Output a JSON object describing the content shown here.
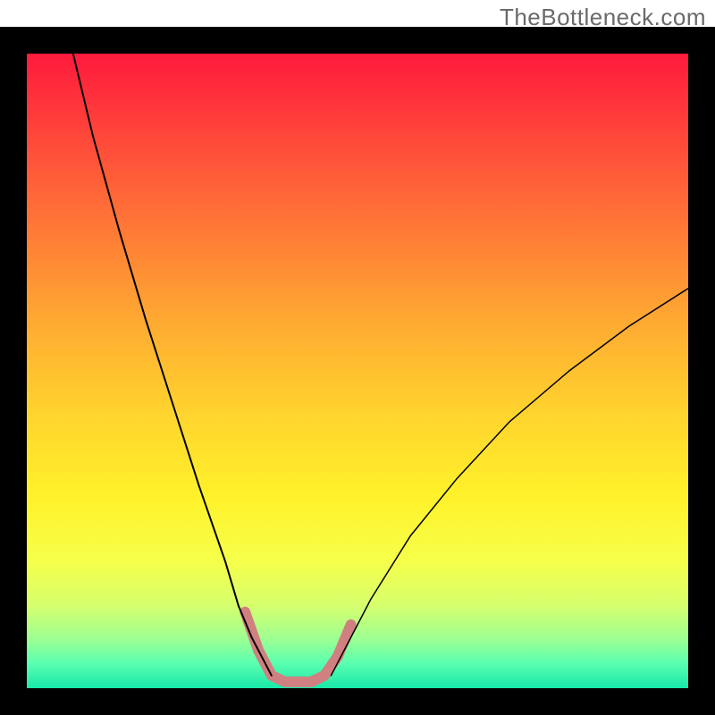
{
  "watermark": "TheBottleneck.com",
  "chart_data": {
    "type": "line",
    "title": "",
    "xlabel": "",
    "ylabel": "",
    "legend": false,
    "xlim": [
      0,
      100
    ],
    "ylim": [
      0,
      100
    ],
    "axes_visible": false,
    "grid": false,
    "background_gradient": {
      "direction": "vertical",
      "stops": [
        {
          "pos": 0,
          "color": "#ff1a3c"
        },
        {
          "pos": 14,
          "color": "#ff4a3a"
        },
        {
          "pos": 28,
          "color": "#ff7a36"
        },
        {
          "pos": 42,
          "color": "#ffa932"
        },
        {
          "pos": 56,
          "color": "#ffd22e"
        },
        {
          "pos": 70,
          "color": "#fff22a"
        },
        {
          "pos": 80,
          "color": "#f6ff4a"
        },
        {
          "pos": 87,
          "color": "#d6ff6e"
        },
        {
          "pos": 92,
          "color": "#a0ff90"
        },
        {
          "pos": 96,
          "color": "#5cffb0"
        },
        {
          "pos": 100,
          "color": "#18e8a8"
        }
      ]
    },
    "series": [
      {
        "name": "left-arm",
        "color": "#000000",
        "width": 2,
        "x": [
          7,
          10,
          14,
          18,
          22,
          26,
          30,
          32,
          34,
          36,
          37
        ],
        "y": [
          100,
          87,
          72,
          58,
          45,
          32,
          20,
          13,
          8,
          4,
          2
        ]
      },
      {
        "name": "right-arm",
        "color": "#000000",
        "width": 1.5,
        "x": [
          46,
          48,
          52,
          58,
          65,
          73,
          82,
          91,
          100
        ],
        "y": [
          2,
          6,
          14,
          24,
          33,
          42,
          50,
          57,
          63
        ]
      },
      {
        "name": "trough-highlight",
        "color": "#d08080",
        "width": 12,
        "x": [
          33,
          35,
          37,
          39,
          41,
          43,
          45,
          47,
          49
        ],
        "y": [
          12,
          6,
          2,
          1,
          1,
          1,
          2,
          5,
          10
        ]
      }
    ],
    "annotations": []
  }
}
